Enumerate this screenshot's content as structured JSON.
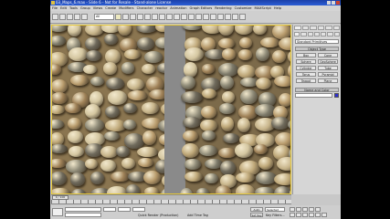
{
  "window": {
    "title": "03_Maps_6.max - Slide 6 - Not for Resale - Stand-alone License"
  },
  "menu": [
    "File",
    "Edit",
    "Tools",
    "Group",
    "Views",
    "Create",
    "Modifiers",
    "Character",
    "reactor",
    "Animation",
    "Graph Editors",
    "Rendering",
    "Customize",
    "MAXScript",
    "Help"
  ],
  "toolbar": {
    "selection_filter": "All",
    "buttons": 22
  },
  "command_panel": {
    "dropdown": "Standard Primitives",
    "rollout_object_type": "Object Type",
    "object_buttons": [
      "Box",
      "Cone",
      "Sphere",
      "GeoSphere",
      "Cylinder",
      "Tube",
      "Torus",
      "Pyramid",
      "Teapot",
      "Plane"
    ],
    "rollout_name_color": "Name and Color"
  },
  "timeline": {
    "frame_label": "0 / 100"
  },
  "status": {
    "render_scene": "Quick Render (Production)",
    "add_time_tag": "Add Time Tag",
    "auto_key": "Auto Key",
    "set_key": "Set Key",
    "selected": "Selected",
    "key_filters": "Key Filters..."
  },
  "colors": {
    "title_bar": "#2c5fd6",
    "viewport_border": "#e6c93a",
    "object_color_swatch": "#2e2fcf"
  }
}
